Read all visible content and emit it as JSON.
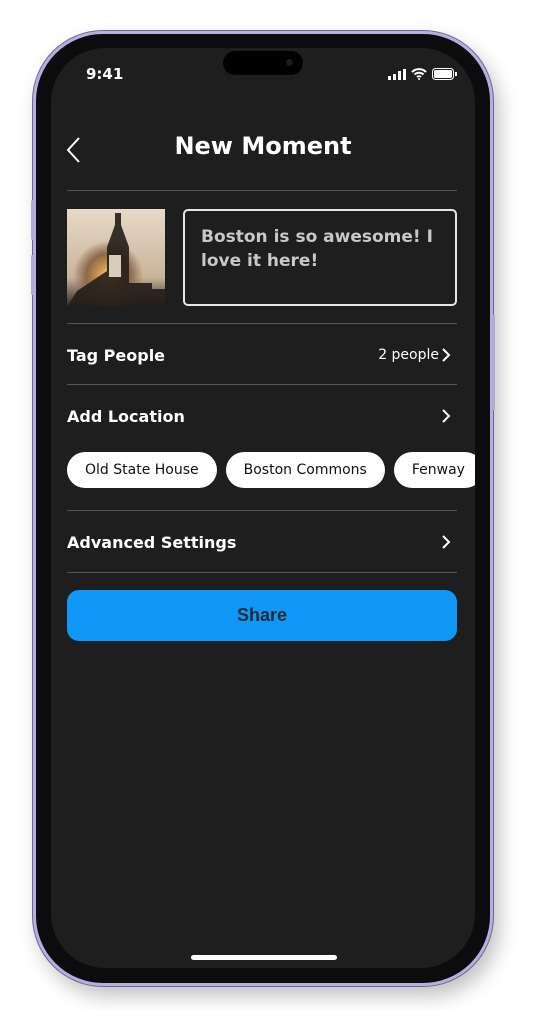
{
  "status_bar": {
    "time": "9:41"
  },
  "header": {
    "title": "New Moment"
  },
  "post": {
    "caption": "Boston is so awesome! I love it here!"
  },
  "tag_people": {
    "label": "Tag People",
    "value": "2 people"
  },
  "add_location": {
    "label": "Add Location",
    "suggestions": [
      "Old State House",
      "Boston Commons",
      "Fenway"
    ]
  },
  "advanced": {
    "label": "Advanced Settings"
  },
  "share": {
    "label": "Share"
  },
  "colors": {
    "accent": "#1098f7",
    "background": "#1e1e1e"
  }
}
